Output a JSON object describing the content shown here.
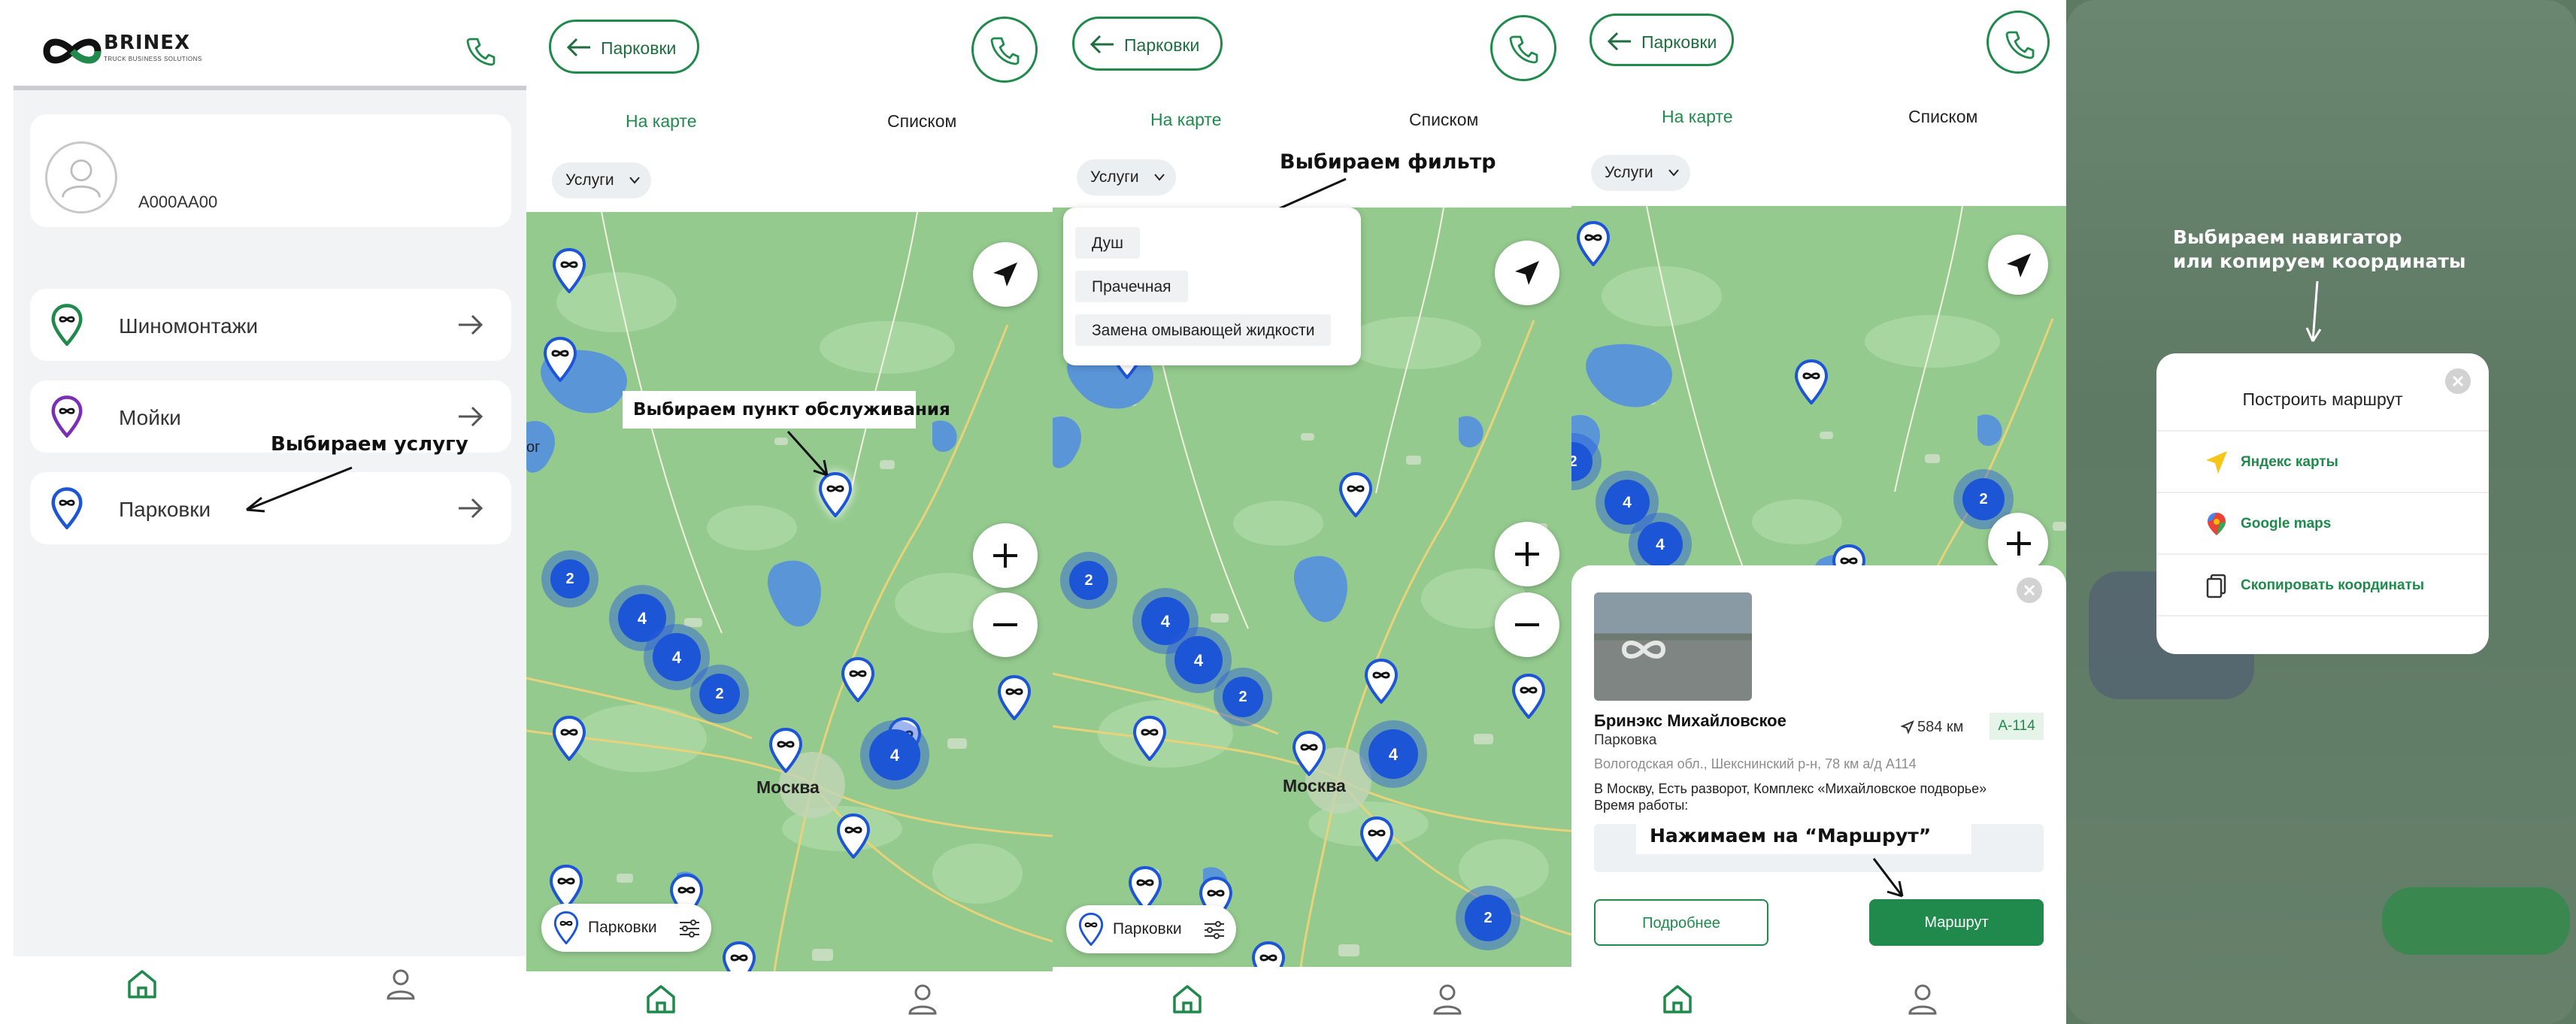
{
  "brand": {
    "name": "BRINEX",
    "tagline": "TRUCK BUSINESS SOLUTIONS"
  },
  "profile": {
    "plate": "А000АА00"
  },
  "services": [
    {
      "label": "Шиномонтажи",
      "pin_color": "#1f8a4c"
    },
    {
      "label": "Мойки",
      "pin_color": "#7b2fb5"
    },
    {
      "label": "Парковки",
      "pin_color": "#1c55d6"
    }
  ],
  "annotations": {
    "choose_service": "Выбираем услугу",
    "choose_point": "Выбираем пункт обслуживания",
    "choose_filter": "Выбираем фильтр",
    "press_route": "Нажимаем на “Маршрут”",
    "choose_nav_line1": "Выбираем навигатор",
    "choose_nav_line2": "или копируем координаты"
  },
  "nav": {
    "back_label": "Парковки",
    "tab_map": "На карте",
    "tab_list": "Списком",
    "filter_chip": "Услуги",
    "bottom_pill": "Парковки"
  },
  "map": {
    "city": "Москва",
    "edge_label": "ог",
    "cluster_values": [
      "2",
      "4",
      "4",
      "2",
      "4",
      "2"
    ]
  },
  "filter_options": [
    "Душ",
    "Прачечная",
    "Замена омывающей жидкости"
  ],
  "station": {
    "name": "Бринэкс Михайловское",
    "type": "Парковка",
    "distance": "584 км",
    "road": "А-114",
    "address": "Вологодская обл., Шекснинский р-н, 78 км а/д А114",
    "description": "В Москву, Есть разворот, Комплекс «Михайловское подворье»",
    "hours_label": "Время работы:",
    "btn_more": "Подробнее",
    "btn_route": "Маршрут"
  },
  "route_modal": {
    "title": "Построить маршрут",
    "options": [
      {
        "label": "Яндекс карты",
        "icon": "yandex-arrow-icon"
      },
      {
        "label": "Google maps",
        "icon": "google-pin-icon"
      },
      {
        "label": "Скопировать координаты",
        "icon": "copy-icon"
      }
    ]
  },
  "colors": {
    "accent": "#1f8a4c",
    "map": "#94ca8e",
    "cluster": "#1c55d6"
  }
}
